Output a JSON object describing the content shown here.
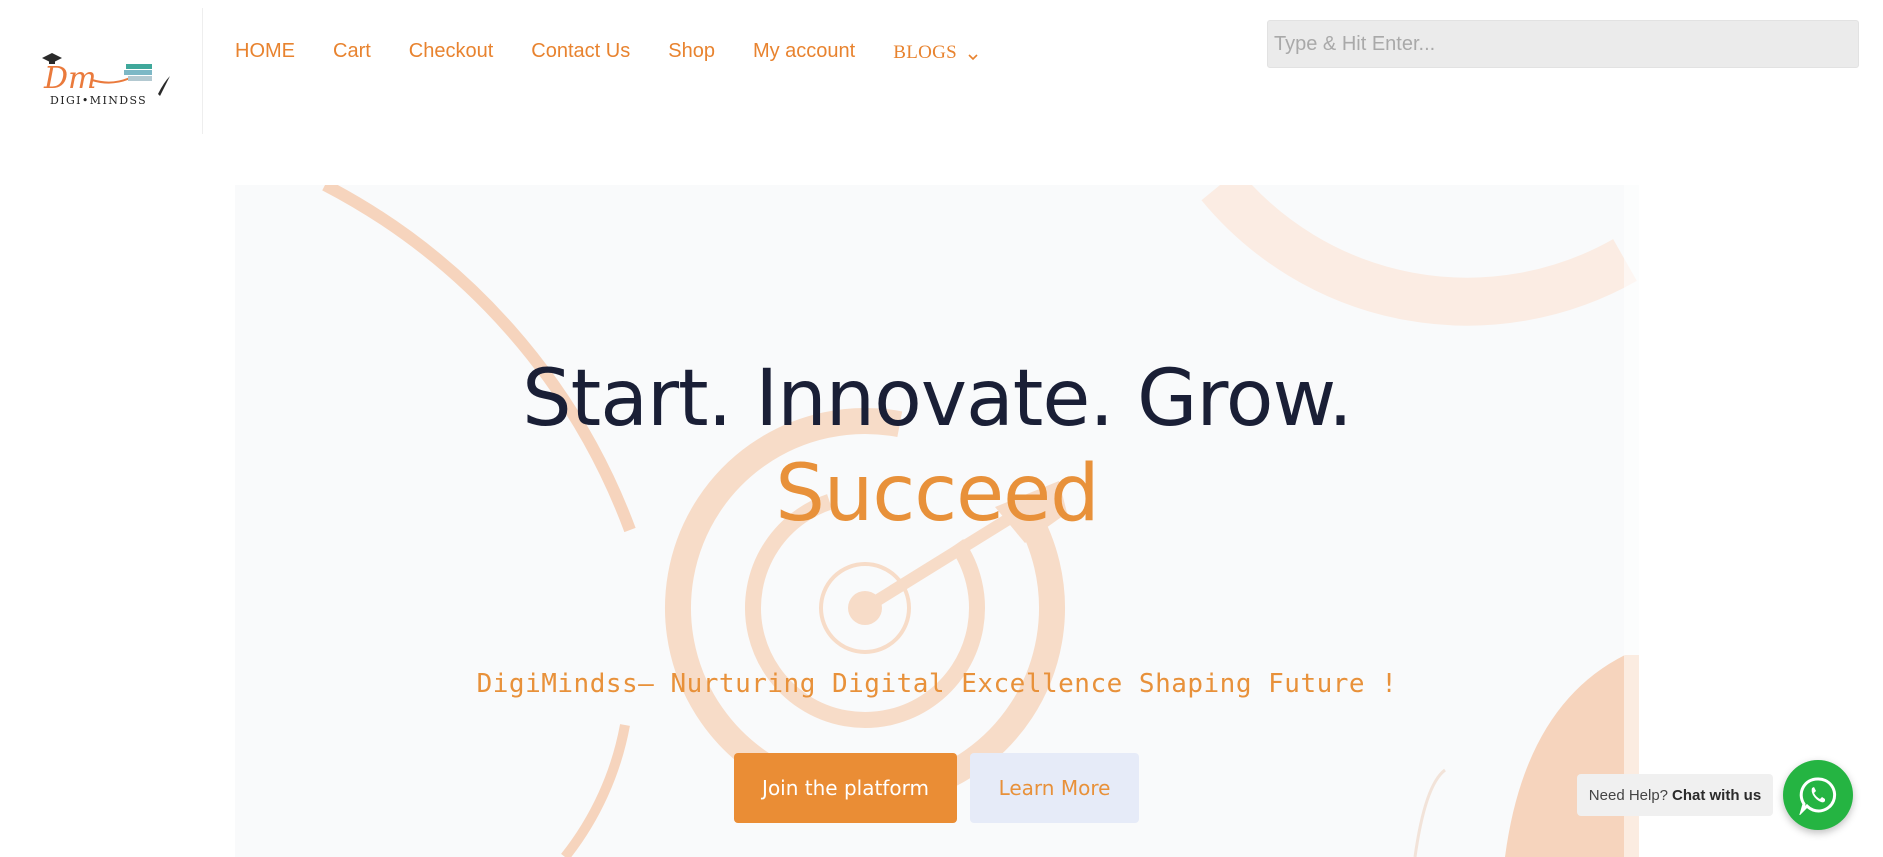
{
  "logo": {
    "monogram": "Dm",
    "wordmark": "DIGI•MINDSS"
  },
  "nav": {
    "items": [
      {
        "label": "HOME"
      },
      {
        "label": "Cart"
      },
      {
        "label": "Checkout"
      },
      {
        "label": "Contact Us"
      },
      {
        "label": "Shop"
      },
      {
        "label": "My account"
      }
    ],
    "blogs": {
      "label": "BLOGS"
    }
  },
  "search": {
    "placeholder": "Type & Hit Enter..."
  },
  "hero": {
    "title": "Start. Innovate. Grow.",
    "title_accent": "Succeed",
    "tagline": "DigiMindss— Nurturing Digital Excellence Shaping Future !",
    "primary_button": "Join the platform",
    "secondary_button": "Learn More"
  },
  "chat_widget": {
    "prefix": "Need Help?",
    "action": "Chat with us"
  },
  "colors": {
    "accent": "#e8913a",
    "nav_text": "#e8832f",
    "heading": "#1a1f36",
    "hero_bg": "#f9fafb",
    "whatsapp_green": "#25b442",
    "secondary_button_bg": "#e6ebf8"
  },
  "icons": {
    "nav_dropdown": "chevron-down-icon",
    "chat": "whatsapp-icon",
    "hero_background": "target-icon"
  }
}
